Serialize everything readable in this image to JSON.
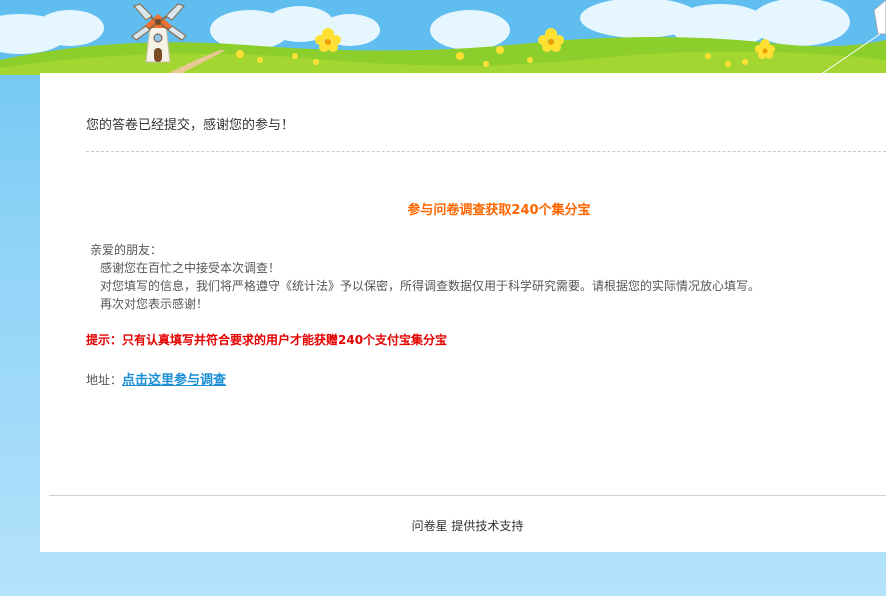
{
  "header": {
    "scene_icons": [
      "windmill-icon",
      "flower-icon",
      "cloud-icon",
      "kite-icon"
    ]
  },
  "main": {
    "submitted_message": "您的答卷已经提交，感谢您的参与！",
    "promo_title": "参与问卷调查获取240个集分宝",
    "letter": {
      "greeting": "亲爱的朋友：",
      "line1": "感谢您在百忙之中接受本次调查！",
      "line2": "对您填写的信息，我们将严格遵守《统计法》予以保密，所得调查数据仅用于科学研究需要。请根据您的实际情况放心填写。",
      "line3": "再次对您表示感谢！"
    },
    "tip": "提示：只有认真填写并符合要求的用户才能获赠240个支付宝集分宝",
    "address_label": "地址：",
    "address_link": "点击这里参与调查"
  },
  "footer": {
    "brand": "问卷星",
    "text": "提供技术支持"
  },
  "colors": {
    "sky": "#6cc5f2",
    "grass": "#a3d630",
    "promo_orange": "#ff6600",
    "tip_red": "#e60000",
    "link_blue": "#1a8fd8"
  }
}
